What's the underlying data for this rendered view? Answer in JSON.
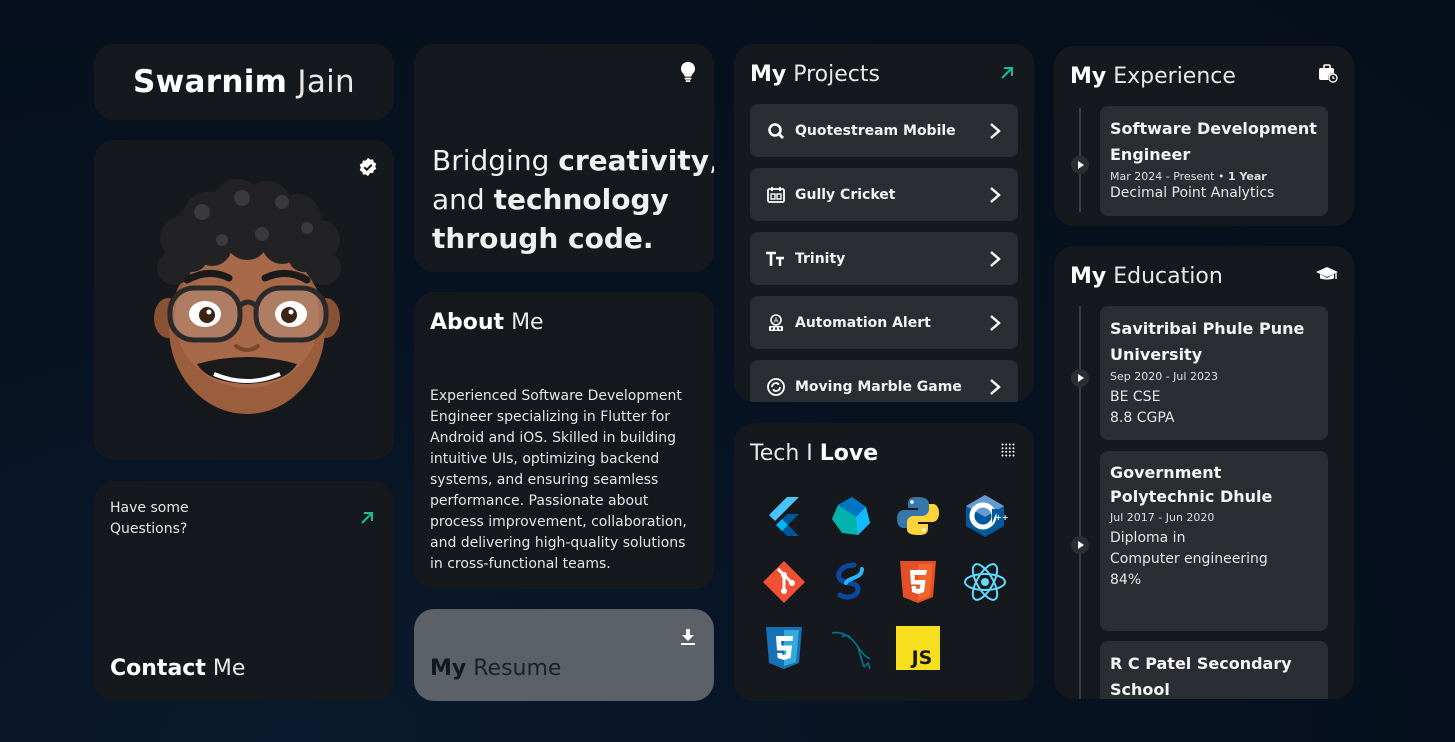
{
  "profile": {
    "first_name": "Swarnim",
    "last_name": "Jain"
  },
  "contact": {
    "question": "Have some\nQuestions?",
    "title_bold": "Contact",
    "title_light": "Me"
  },
  "tagline": {
    "p1": "Bridging ",
    "p2": "creativity",
    "p3": ",",
    "p4": "and ",
    "p5": "technology",
    "p6": "through code."
  },
  "about": {
    "title_bold": "About",
    "title_light": "Me",
    "text": "Experienced Software Development Engineer specializing in Flutter for Android and iOS. Skilled in building intuitive UIs, optimizing backend systems, and ensuring seamless performance. Passionate about process improvement, collaboration, and delivering high-quality solutions in cross-functional teams."
  },
  "resume": {
    "title_bold": "My",
    "title_light": "Resume"
  },
  "projects": {
    "title_bold": "My",
    "title_light": "Projects",
    "items": [
      {
        "label": "Quotestream Mobile",
        "icon": "q-logo-icon"
      },
      {
        "label": "Gully Cricket",
        "icon": "scoreboard-icon"
      },
      {
        "label": "Trinity",
        "icon": "text-tt-icon"
      },
      {
        "label": "Automation Alert",
        "icon": "alert-bot-icon"
      },
      {
        "label": "Moving Marble Game",
        "icon": "marble-icon"
      }
    ]
  },
  "tech": {
    "title_light": "Tech",
    "separator": "I",
    "title_bold": "Love",
    "items": [
      "flutter",
      "dart",
      "python",
      "c++",
      "git",
      "swift-ui",
      "html5",
      "react",
      "css3",
      "mysql",
      "js"
    ]
  },
  "experience": {
    "title_bold": "My",
    "title_light": "Experience",
    "entries": [
      {
        "title": "Software Development Engineer",
        "dates": "Mar 2024 - Present",
        "duration": "1 Year",
        "org": "Decimal Point Analytics"
      }
    ]
  },
  "education": {
    "title_bold": "My",
    "title_light": "Education",
    "entries": [
      {
        "title": "Savitribai Phule Pune University",
        "dates": "Sep 2020 - Jul 2023",
        "line1": "BE CSE",
        "line2": "8.8 CGPA",
        "line3": ""
      },
      {
        "title": "Government Polytechnic Dhule",
        "dates": "Jul 2017 - Jun 2020",
        "line1": "Diploma in",
        "line2": "Computer engineering",
        "line3": "84%"
      },
      {
        "title": "R C Patel Secondary School",
        "dates": "",
        "line1": "",
        "line2": "",
        "line3": ""
      }
    ]
  },
  "colors": {
    "accent": "#1abc9c",
    "card": "#15181d",
    "tile": "#2a2d32",
    "resume_card": "#5c6167"
  }
}
